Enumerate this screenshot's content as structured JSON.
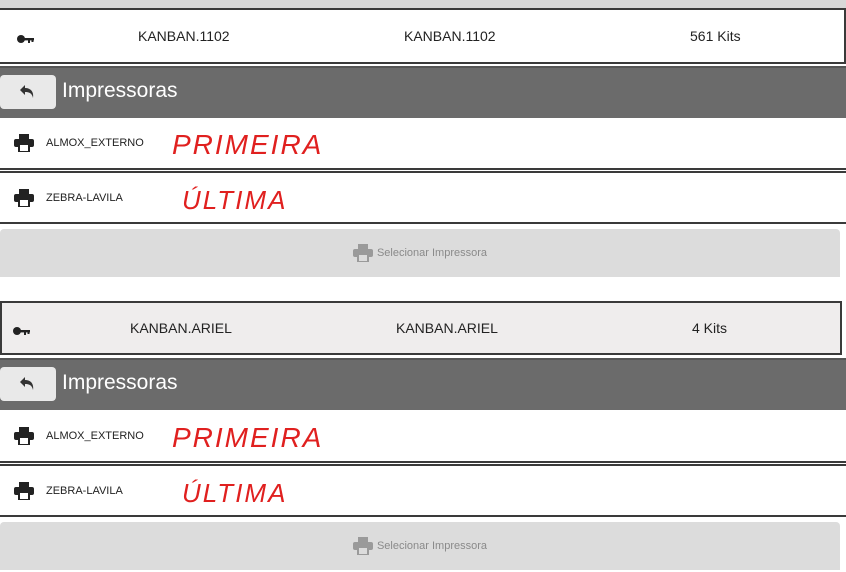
{
  "panels": [
    {
      "kanban": {
        "col1": "KANBAN.1102",
        "col2": "KANBAN.1102",
        "col3": "561 Kits"
      },
      "header": {
        "title": "Impressoras"
      },
      "printers": [
        {
          "name": "ALMOX_EXTERNO",
          "annotation": "PRIMEIRA"
        },
        {
          "name": "ZEBRA-LAVILA",
          "annotation": "ÚLTIMA"
        }
      ],
      "select_button": "Selecionar Impressora"
    },
    {
      "kanban": {
        "col1": "KANBAN.ARIEL",
        "col2": "KANBAN.ARIEL",
        "col3": "4 Kits"
      },
      "header": {
        "title": "Impressoras"
      },
      "printers": [
        {
          "name": "ALMOX_EXTERNO",
          "annotation": "PRIMEIRA"
        },
        {
          "name": "ZEBRA-LAVILA",
          "annotation": "ÚLTIMA"
        }
      ],
      "select_button": "Selecionar Impressora"
    }
  ],
  "icons": {
    "key": "key-icon",
    "back": "back-arrow-icon",
    "printer": "printer-icon"
  },
  "colors": {
    "header_bg": "#6b6b6b",
    "annotation_red": "#e0201f",
    "button_bg": "#dcdcdc"
  }
}
